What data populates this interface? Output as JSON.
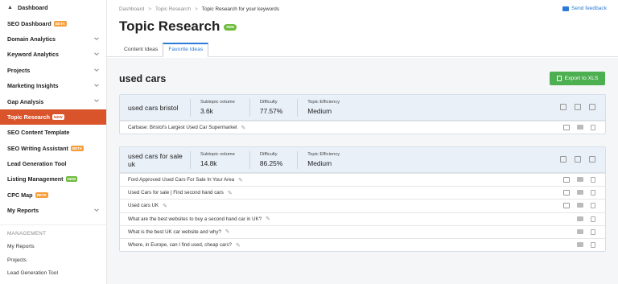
{
  "sidebar": {
    "items": [
      {
        "label": "Dashboard",
        "badge": "",
        "chevron": false
      },
      {
        "label": "SEO Dashboard",
        "badge": "beta",
        "chevron": false
      },
      {
        "label": "Domain Analytics",
        "badge": "",
        "chevron": true
      },
      {
        "label": "Keyword Analytics",
        "badge": "",
        "chevron": true
      },
      {
        "label": "Projects",
        "badge": "",
        "chevron": true
      },
      {
        "label": "Marketing Insights",
        "badge": "",
        "chevron": true
      },
      {
        "label": "Gap Analysis",
        "badge": "",
        "chevron": true
      },
      {
        "label": "Topic Research",
        "badge": "new",
        "chevron": false,
        "active": true
      },
      {
        "label": "SEO Content Template",
        "badge": "",
        "chevron": false
      },
      {
        "label": "SEO Writing Assistant",
        "badge": "beta",
        "chevron": false
      },
      {
        "label": "Lead Generation Tool",
        "badge": "",
        "chevron": false
      },
      {
        "label": "Listing Management",
        "badge": "new",
        "chevron": false
      },
      {
        "label": "CPC Map",
        "badge": "beta",
        "chevron": false
      },
      {
        "label": "My Reports",
        "badge": "",
        "chevron": true
      }
    ],
    "management_heading": "MANAGEMENT",
    "management_items": [
      "My Reports",
      "Projects",
      "Lead Generation Tool"
    ]
  },
  "breadcrumb": {
    "items": [
      "Dashboard",
      "Topic Research",
      "Topic Research for your keywords"
    ],
    "separator": ">"
  },
  "feedback_label": "Send feedback",
  "page": {
    "title": "Topic Research",
    "title_badge": "new"
  },
  "tabs": [
    "Content Ideas",
    "Favorite Ideas"
  ],
  "active_tab": "Favorite Ideas",
  "section_title": "used cars",
  "export_label": "Export to XLS",
  "cards": [
    {
      "topic": "used cars bristol",
      "metrics": [
        {
          "label": "Subtopic volume",
          "value": "3.6k"
        },
        {
          "label": "Difficulty",
          "value": "77.57%"
        },
        {
          "label": "Topic Efficiency",
          "value": "Medium"
        }
      ],
      "rows": [
        {
          "text": "Carbase: Bristol's Largest Used Car Supermarket",
          "link": true
        }
      ]
    },
    {
      "topic": "used cars for sale uk",
      "metrics": [
        {
          "label": "Subtopic volume",
          "value": "14.8k"
        },
        {
          "label": "Difficulty",
          "value": "86.25%"
        },
        {
          "label": "Topic Efficiency",
          "value": "Medium"
        }
      ],
      "rows": [
        {
          "text": "Ford Approved Used Cars For Sale In Your Area",
          "link": true
        },
        {
          "text": "Used Cars for sale | Find second hand cars",
          "link": true
        },
        {
          "text": "Used cars UK",
          "link": true
        },
        {
          "text": "What are the best websites to buy a second hand car in UK?",
          "link": false
        },
        {
          "text": "What is the best UK car website and why?",
          "link": false
        },
        {
          "text": "Where, in Europe, can I find used, cheap cars?",
          "link": false
        }
      ]
    }
  ],
  "colors": {
    "accent": "#2b7bd6",
    "active_nav": "#d9532b",
    "export_button": "#4caf50",
    "new_badge": "#6dbb3c",
    "beta_badge": "#f59e3b"
  }
}
